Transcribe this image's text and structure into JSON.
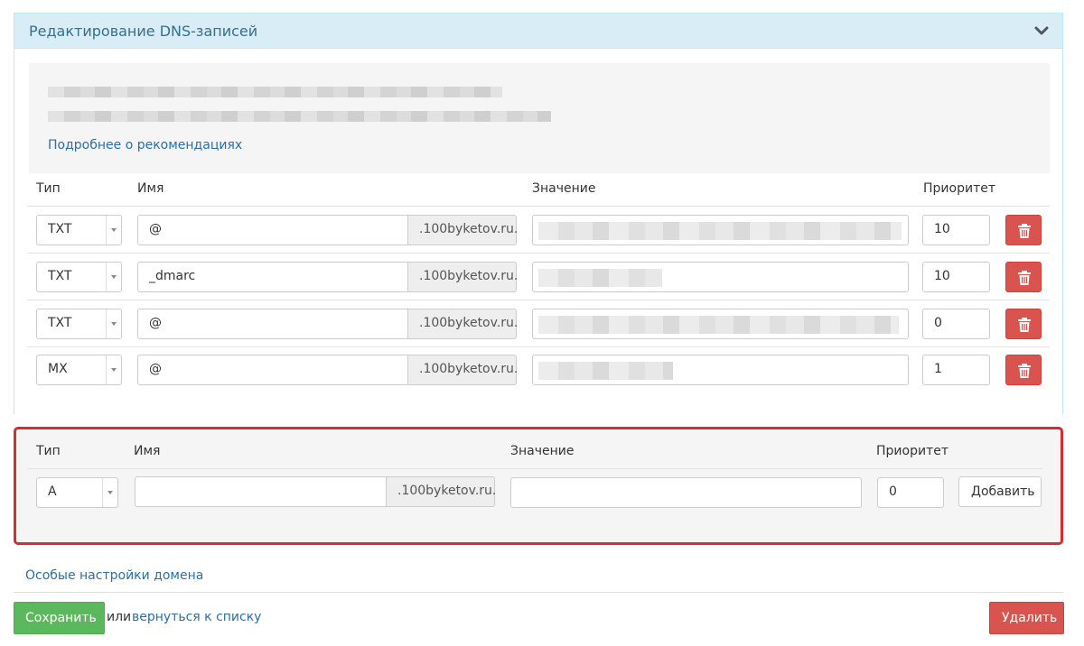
{
  "panel": {
    "title": "Редактирование DNS-записей",
    "chevron_icon": "chevron-down-icon"
  },
  "recommendation": {
    "more_link": "Подробнее о рекомендациях"
  },
  "columns": {
    "type": "Тип",
    "name": "Имя",
    "value": "Значение",
    "priority": "Приоритет"
  },
  "records": [
    {
      "type": "TXT",
      "name": "@",
      "suffix": ".100byketov.ru.",
      "priority": "10"
    },
    {
      "type": "TXT",
      "name": "_dmarc",
      "suffix": ".100byketov.ru.",
      "priority": "10"
    },
    {
      "type": "TXT",
      "name": "@",
      "suffix": ".100byketov.ru.",
      "priority": "0"
    },
    {
      "type": "MX",
      "name": "@",
      "suffix": ".100byketov.ru.",
      "priority": "1"
    }
  ],
  "new_record": {
    "type": "A",
    "name": "",
    "suffix": ".100byketov.ru.",
    "value": "",
    "priority": "0",
    "add_button": "Добавить"
  },
  "footer": {
    "special_settings_link": "Особые настройки домена",
    "save_button": "Сохранить",
    "or_text": "или",
    "back_link": "вернуться к списку",
    "delete_button": "Удалить"
  },
  "colors": {
    "heading_bg": "#d9edf7",
    "heading_text": "#31708f",
    "link": "#2a6fa8",
    "danger": "#d9534f",
    "success": "#5cb85c",
    "highlight_border": "#d32f2f"
  }
}
